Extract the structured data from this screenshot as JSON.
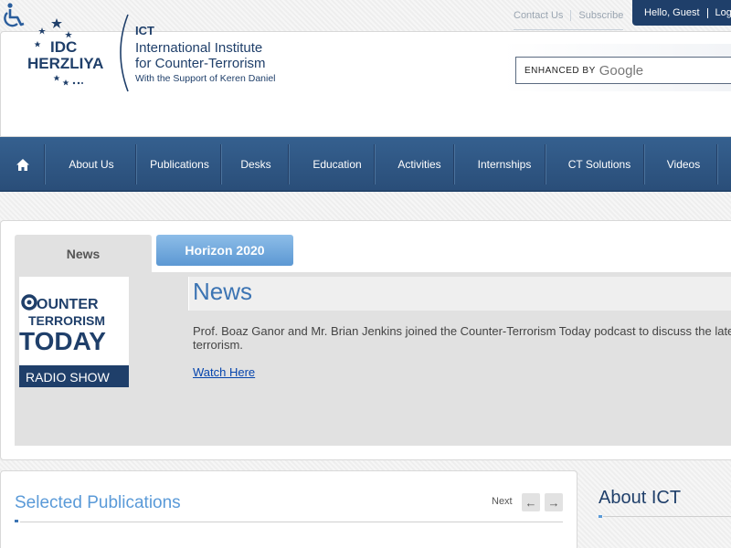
{
  "accessibility": {
    "icon": "wheelchair-icon"
  },
  "header": {
    "logo": {
      "idc_line1": "IDC",
      "idc_line2": "HERZLIYA",
      "ict_mark": "ICT",
      "institute_line1": "International Institute",
      "institute_line2": "for Counter-Terrorism",
      "support_line": "With the Support of Keren Daniel"
    },
    "top_links": [
      "Contact Us",
      "Subscribe"
    ],
    "user": {
      "greeting": "Hello, Guest",
      "login": "Log"
    },
    "search": {
      "label": "ENHANCED BY",
      "brand": "Google"
    }
  },
  "nav": {
    "home_icon": "home-icon",
    "items": [
      "About Us",
      "Publications",
      "Desks",
      "Education",
      "Activities",
      "Internships",
      "CT Solutions",
      "Videos"
    ]
  },
  "news": {
    "tabs": {
      "active": "News",
      "other": "Horizon 2020"
    },
    "image": {
      "line1": "OUNTER",
      "line2": "TERRORISM",
      "line3": "TODAY",
      "line4": "RADIO SHOW"
    },
    "title": "News",
    "text": "Prof. Boaz Ganor and Mr. Brian Jenkins joined the Counter-Terrorism Today podcast to discuss the late terrorism.",
    "link": "Watch Here"
  },
  "publications": {
    "title": "Selected Publications",
    "next_label": "Next",
    "prev_arrow": "←",
    "next_arrow": "→"
  },
  "about": {
    "title": "About ICT"
  },
  "colors": {
    "nav": "#2f5888",
    "accent": "#3c74b3",
    "dark_blue": "#1f3f6a"
  }
}
